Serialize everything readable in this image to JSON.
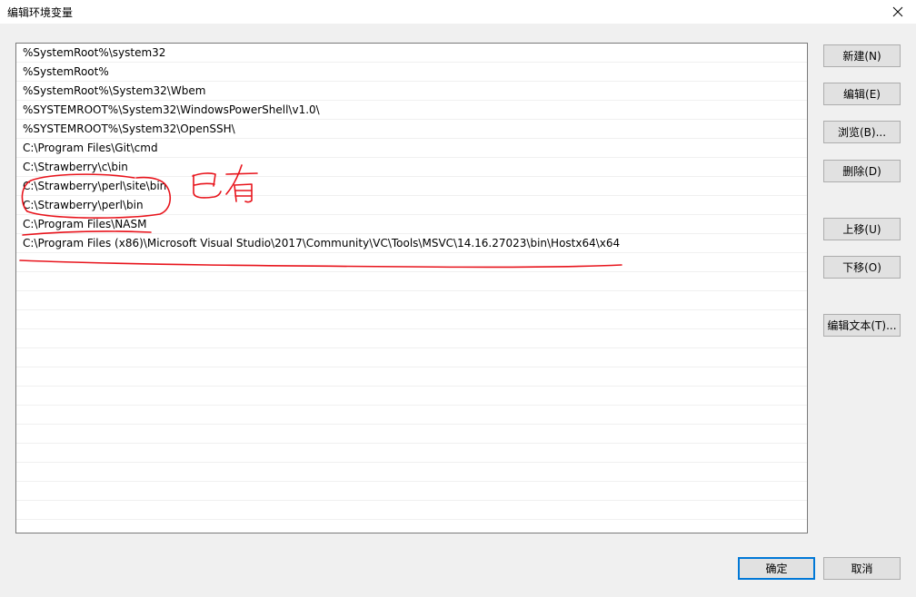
{
  "window": {
    "title": "编辑环境变量"
  },
  "path_list": [
    "%SystemRoot%\\system32",
    "%SystemRoot%",
    "%SystemRoot%\\System32\\Wbem",
    "%SYSTEMROOT%\\System32\\WindowsPowerShell\\v1.0\\",
    "%SYSTEMROOT%\\System32\\OpenSSH\\",
    "C:\\Program Files\\Git\\cmd",
    "C:\\Strawberry\\c\\bin",
    "C:\\Strawberry\\perl\\site\\bin",
    "C:\\Strawberry\\perl\\bin",
    "C:\\Program Files\\NASM",
    "C:\\Program Files (x86)\\Microsoft Visual Studio\\2017\\Community\\VC\\Tools\\MSVC\\14.16.27023\\bin\\Hostx64\\x64",
    "",
    "",
    "",
    "",
    "",
    "",
    "",
    "",
    "",
    "",
    "",
    "",
    "",
    "",
    ""
  ],
  "buttons": {
    "new": "新建(N)",
    "edit": "编辑(E)",
    "browse": "浏览(B)...",
    "delete": "删除(D)",
    "move_up": "上移(U)",
    "move_down": "下移(O)",
    "edit_text": "编辑文本(T)...",
    "ok": "确定",
    "cancel": "取消"
  },
  "annotation": {
    "handwritten_note": "已有",
    "ink_color": "#e8141c"
  }
}
